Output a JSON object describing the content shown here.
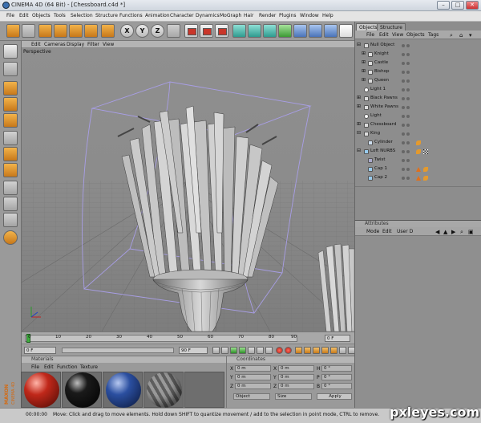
{
  "window": {
    "title": "CINEMA 4D (64 Bit) - [Chessboard.c4d *]",
    "controls": [
      "–",
      "□",
      "✕"
    ]
  },
  "menubar": [
    "File",
    "Edit",
    "Objects",
    "Tools",
    "Selection",
    "Structure",
    "Functions",
    "Animation",
    "Character",
    "Dynamics",
    "MoGraph",
    "Hair",
    "Render",
    "Plugins",
    "Window",
    "Help"
  ],
  "toolbar": {
    "axis_x": "X",
    "axis_y": "Y",
    "axis_z": "Z",
    "icons": [
      "undo-icon",
      "redo-icon",
      "live-selection-icon",
      "move-icon",
      "scale-icon",
      "rotate-icon",
      "add-icon",
      "x-axis-icon",
      "y-axis-icon",
      "z-axis-icon",
      "world-coord-icon",
      "render-view-icon",
      "render-picture-viewer-icon",
      "render-settings-icon",
      "cube-icon",
      "spline-icon",
      "nurbs-icon",
      "array-icon",
      "deformer-icon",
      "scene-icon",
      "camera-icon",
      "light-icon"
    ]
  },
  "viewport": {
    "menu": [
      "Edit",
      "Cameras",
      "Display",
      "Filter",
      "View"
    ],
    "label": "Perspective"
  },
  "timeline": {
    "ticks": [
      "0",
      "10",
      "20",
      "30",
      "40",
      "50",
      "60",
      "70",
      "80",
      "90"
    ],
    "end_frame": "0 F"
  },
  "transport": {
    "current_frame": "0 F",
    "start_field": "0 F",
    "end_field": "90 F",
    "end_field2": "90 F"
  },
  "materials": {
    "header": "Materials",
    "menu": [
      "File",
      "Edit",
      "Function",
      "Texture"
    ],
    "swatch_colors": [
      "#c0281a",
      "#1a1a1a",
      "#2b4fa0",
      "#6f6f6f"
    ]
  },
  "coordinates": {
    "header": "Coordinates",
    "rows": [
      {
        "a": "X",
        "v1": "0 m",
        "b": "X",
        "v2": "0 m",
        "c": "H",
        "v3": "0 °"
      },
      {
        "a": "Y",
        "v1": "0 m",
        "b": "Y",
        "v2": "0 m",
        "c": "P",
        "v3": "0 °"
      },
      {
        "a": "Z",
        "v1": "0 m",
        "b": "Z",
        "v2": "0 m",
        "c": "B",
        "v3": "0 °"
      }
    ],
    "mode1": "Object",
    "mode2": "Size",
    "apply": "Apply"
  },
  "objects_panel": {
    "tabs": [
      "Objects",
      "Structure"
    ],
    "menu": [
      "File",
      "Edit",
      "View",
      "Objects",
      "Tags"
    ],
    "items": [
      {
        "name": "Null Object",
        "indent": 0,
        "tags": []
      },
      {
        "name": "Knight",
        "indent": 1,
        "tags": []
      },
      {
        "name": "Castle",
        "indent": 1,
        "tags": []
      },
      {
        "name": "Bishop",
        "indent": 1,
        "tags": []
      },
      {
        "name": "Queen",
        "indent": 1,
        "tags": []
      },
      {
        "name": "Light 1",
        "indent": 0,
        "tags": []
      },
      {
        "name": "Black Pawns",
        "indent": 0,
        "tags": []
      },
      {
        "name": "White Pawns",
        "indent": 0,
        "tags": []
      },
      {
        "name": "Light",
        "indent": 0,
        "tags": []
      },
      {
        "name": "Chessboard",
        "indent": 0,
        "tags": []
      },
      {
        "name": "King",
        "indent": 0,
        "tags": []
      },
      {
        "name": "Cylinder",
        "indent": 1,
        "tags": [
          "phong"
        ]
      },
      {
        "name": "Loft NURBS",
        "indent": 0,
        "tags": [
          "phong",
          "texture"
        ]
      },
      {
        "name": "Twist",
        "indent": 1,
        "tags": []
      },
      {
        "name": "Cap 1",
        "indent": 1,
        "tags": [
          "warning",
          "phong"
        ]
      },
      {
        "name": "Cap 2",
        "indent": 1,
        "tags": [
          "warning",
          "phong"
        ]
      }
    ]
  },
  "attributes_panel": {
    "header": "Attributes",
    "menu": [
      "Mode",
      "Edit",
      "User D"
    ]
  },
  "statusbar": {
    "time": "00:00:00",
    "message": "Move: Click and drag to move elements. Hold down SHIFT to quantize movement / add to the selection in point mode, CTRL to remove."
  },
  "brand": {
    "line1": "MAXON",
    "line2": "CINEMA 4D"
  },
  "watermark": "pxleyes.com",
  "colors": {
    "accent_orange": "#e0701c",
    "viewport_bg": "#8d8d8d",
    "bbox_purple": "#9a8fe0"
  }
}
